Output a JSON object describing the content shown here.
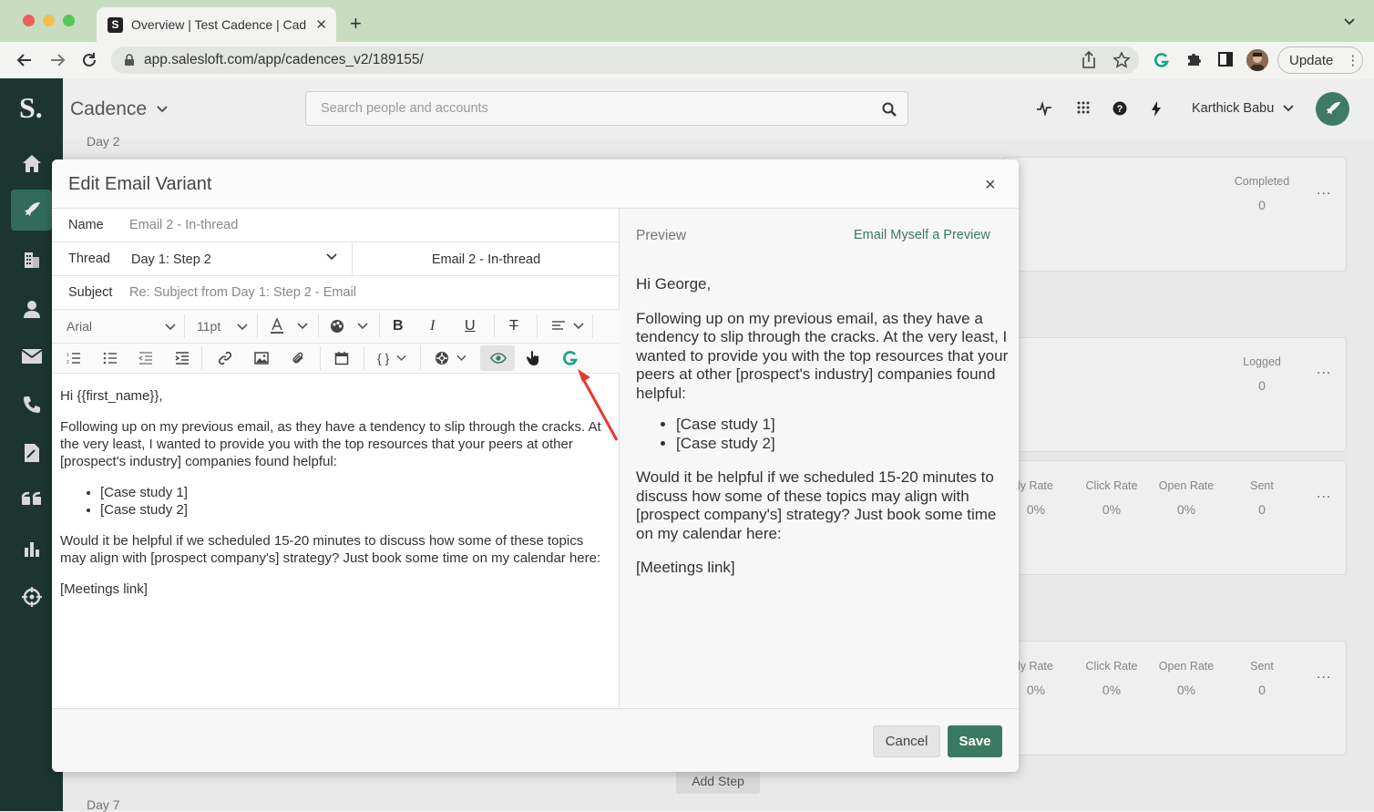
{
  "browser": {
    "tab_title": "Overview | Test Cadence | Cad",
    "tab_favicon": "S",
    "url": "app.salesloft.com/app/cadences_v2/189155/",
    "update_label": "Update",
    "traffic_colors": [
      "#ec5f57",
      "#f5be4f",
      "#58c656"
    ]
  },
  "app": {
    "logo": "S.",
    "section": "Cadence",
    "search_placeholder": "Search people and accounts",
    "user_name": "Karthick Babu",
    "sidebar_icons": [
      "home-icon",
      "rocket-icon",
      "building-icon",
      "person-icon",
      "mail-icon",
      "phone-icon",
      "document-icon",
      "quote-icon",
      "bar-chart-icon",
      "target-icon"
    ]
  },
  "background": {
    "day2": "Day 2",
    "day7": "Day 7",
    "add_step": "Add Step",
    "cards": [
      {
        "stats": [
          {
            "label": "Completed",
            "value": "0"
          }
        ]
      },
      {
        "stats": [
          {
            "label": "Logged",
            "value": "0"
          }
        ]
      },
      {
        "stats": [
          {
            "label": "ply Rate",
            "value": "0%"
          },
          {
            "label": "Click Rate",
            "value": "0%"
          },
          {
            "label": "Open Rate",
            "value": "0%"
          },
          {
            "label": "Sent",
            "value": "0"
          }
        ]
      },
      {
        "stats": [
          {
            "label": "ply Rate",
            "value": "0%"
          },
          {
            "label": "Click Rate",
            "value": "0%"
          },
          {
            "label": "Open Rate",
            "value": "0%"
          },
          {
            "label": "Sent",
            "value": "0"
          }
        ]
      }
    ],
    "more": "..."
  },
  "modal": {
    "title": "Edit Email Variant",
    "close": "×",
    "name_label": "Name",
    "name_value": "Email 2 - In-thread",
    "thread_label": "Thread",
    "thread_value": "Day 1: Step 2",
    "thread_email": "Email 2 - In-thread",
    "subject_label": "Subject",
    "subject_value": "Re: Subject from Day 1: Step 2 - Email",
    "font_family": "Arial",
    "font_size": "11pt",
    "editor": {
      "greeting": "Hi {{first_name}},",
      "para1": "Following up on my previous email, as they have a tendency to slip through the cracks. At the very least, I wanted to provide you with the top resources that your peers at other [prospect's industry] companies found helpful:",
      "bullets": [
        "[Case study 1]",
        "[Case study 2]"
      ],
      "para2": "Would it be helpful if we scheduled 15-20 minutes to discuss how some of these topics may align with [prospect company's] strategy? Just book some time on my calendar here:",
      "link": "[Meetings link]"
    },
    "preview_label": "Preview",
    "email_myself": "Email Myself a Preview",
    "preview": {
      "greeting": "Hi George,",
      "para1": "Following up on my previous email, as they have a tendency to slip through the cracks. At the very least, I wanted to provide you with the top resources that your peers at other [prospect's industry] companies found helpful:",
      "bullets": [
        "[Case study 1]",
        "[Case study 2]"
      ],
      "para2": "Would it be helpful if we scheduled 15-20 minutes to discuss how some of these topics may align with [prospect company's] strategy? Just book some time on my calendar here:",
      "link": "[Meetings link]"
    },
    "cancel": "Cancel",
    "save": "Save",
    "accent": "#3b7a62",
    "annotation_arrow_color": "#e8392b"
  }
}
